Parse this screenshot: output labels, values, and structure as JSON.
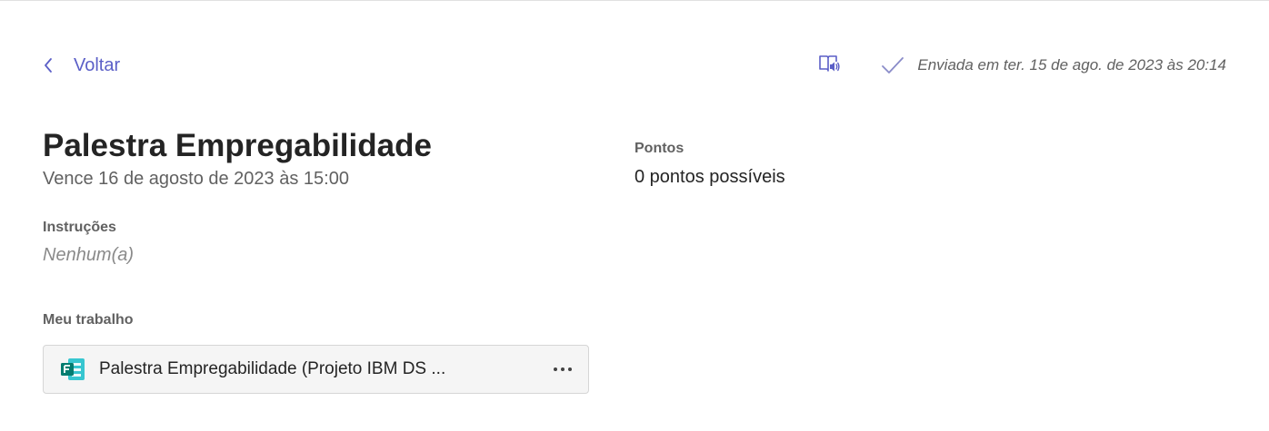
{
  "header": {
    "back_label": "Voltar",
    "status_text": "Enviada em ter. 15 de ago. de 2023 às 20:14",
    "icons": {
      "back": "chevron-left-icon",
      "reader": "immersive-reader-icon",
      "status": "checkmark-icon"
    }
  },
  "assignment": {
    "title": "Palestra Empregabilidade",
    "due": "Vence 16 de agosto de 2023 às 15:00",
    "instructions_label": "Instruções",
    "instructions_value": "Nenhum(a)",
    "work_label": "Meu trabalho",
    "work_item": {
      "name": "Palestra Empregabilidade (Projeto IBM DS ...",
      "icon": "forms-icon",
      "more_icon": "more-options-icon"
    }
  },
  "points": {
    "label": "Pontos",
    "value": "0 pontos possíveis"
  },
  "colors": {
    "accent": "#5b5fc7",
    "forms_green": "#037c6f",
    "text_primary": "#242424",
    "text_secondary": "#616161"
  }
}
